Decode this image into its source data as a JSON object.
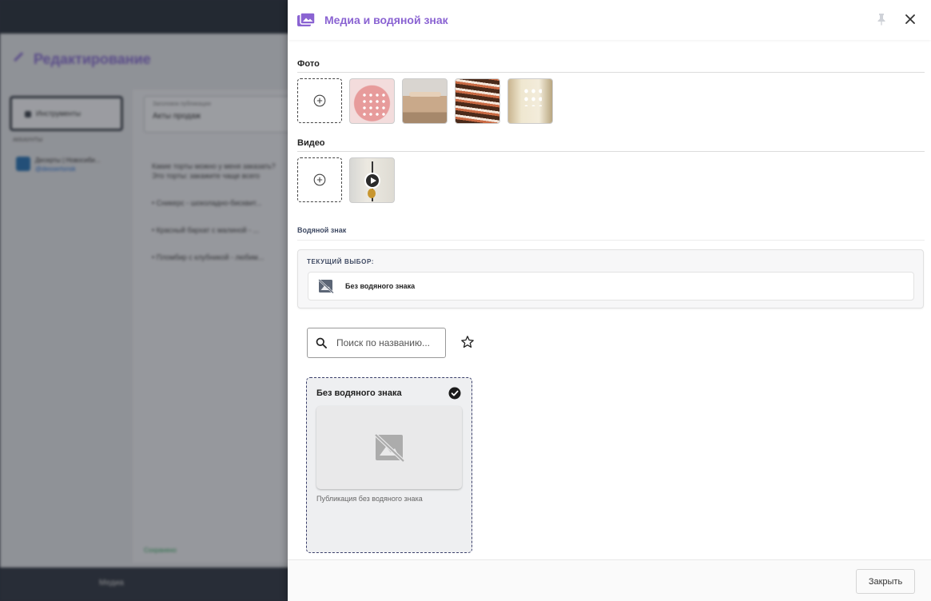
{
  "background": {
    "page_title": "Редактирование",
    "tool_label": "Инструменты",
    "sub_label": "АККАУНТЫ",
    "account_name": "Десерты | Новосиби...",
    "account_link": "@dessertsnsk",
    "field_label": "Заголовок публикации",
    "field_value": "Акты продаж",
    "text_lines": [
      "Какие торты можно у меня заказать?",
      "Это торты: закажите чаще всего",
      "• Сникерс - шоколадно-бисквит...",
      "• Красный бархат с малиной - ...",
      "• Пломбир с клубникой - любим..."
    ],
    "saved_label": "Сохранено",
    "bottom_label": "Медиа"
  },
  "drawer": {
    "title": "Медиа и водяной знак",
    "photo_label": "Фото",
    "video_label": "Видео",
    "watermark_label": "Водяной знак",
    "current_title": "ТЕКУЩИЙ ВЫБОР:",
    "current_name": "Без водяного знака",
    "search_placeholder": "Поиск по названию...",
    "card_title": "Без водяного знака",
    "card_description": "Публикация без водяного знака",
    "close_button": "Закрыть"
  },
  "colors": {
    "accent": "#8a63d2",
    "label_dark": "#3f4a63"
  }
}
